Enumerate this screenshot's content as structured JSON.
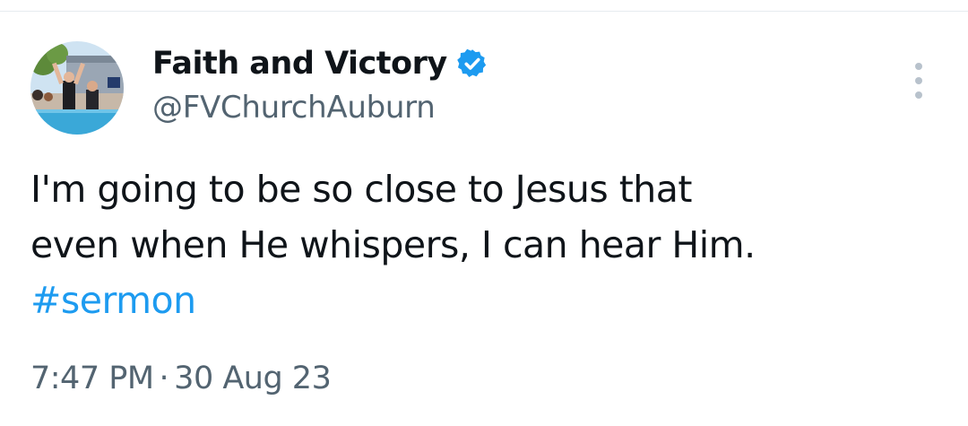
{
  "author": {
    "display_name": "Faith and Victory",
    "handle": "@FVChurchAuburn",
    "verified": true,
    "avatar_icon": "profile-photo-baptism"
  },
  "tweet": {
    "text_lines": [
      "I'm going to be so close to Jesus that",
      "even when He whispers, I can hear Him."
    ],
    "hashtag": "#sermon",
    "time": "7:47 PM",
    "separator": "·",
    "date": "30 Aug 23"
  },
  "colors": {
    "text": "#0f1419",
    "secondary": "#536471",
    "accent": "#1d9bf0",
    "verified_badge": "#1d9bf0"
  },
  "icons": {
    "more": "more-vertical-icon",
    "verified": "verified-badge-icon"
  }
}
